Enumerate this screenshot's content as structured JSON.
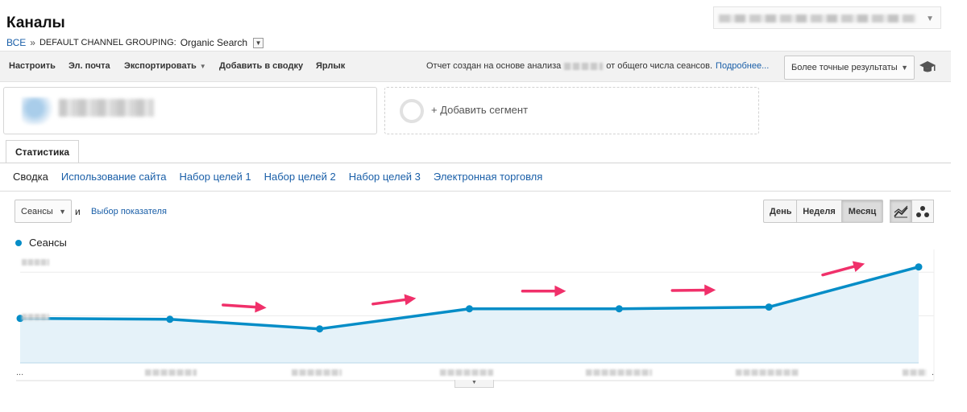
{
  "page": {
    "title": "Каналы"
  },
  "breadcrumb": {
    "all": "ВСЕ",
    "separator": "»",
    "grouping": "DEFAULT CHANNEL GROUPING:",
    "value": "Organic Search"
  },
  "toolbar": {
    "items": [
      "Настроить",
      "Эл. почта",
      "Экспортировать",
      "Добавить в сводку",
      "Ярлык"
    ],
    "note_before": "Отчет создан на основе анализа",
    "note_after": "от общего числа сеансов.",
    "note_link": "Подробнее...",
    "precision_label": "Более точные результаты"
  },
  "segments": {
    "add_label": "+ Добавить сегмент"
  },
  "tabs": {
    "main": "Статистика"
  },
  "subtabs": [
    "Сводка",
    "Использование сайта",
    "Набор целей 1",
    "Набор целей 2",
    "Набор целей 3",
    "Электронная торговля"
  ],
  "chart_controls": {
    "metric": "Сеансы",
    "and": "и",
    "pick_metric": "Выбор показателя",
    "periods": [
      "День",
      "Неделя",
      "Месяц"
    ],
    "active_period": "Месяц",
    "chart_types": [
      "line-chart-icon",
      "motion-chart-icon"
    ]
  },
  "colors": {
    "series": "#058dc7",
    "fill": "#e5f2f9",
    "annotation_arrow": "#f0306a",
    "link": "#1a5fa8"
  },
  "chart_data": {
    "type": "area",
    "x": [
      "",
      "",
      "",
      "",
      "",
      "",
      ""
    ],
    "series": [
      {
        "name": "Сеансы",
        "values": [
          0.51,
          0.5,
          0.39,
          0.62,
          0.62,
          0.64,
          1.1
        ]
      }
    ],
    "annotations": [
      "arrow",
      "arrow",
      "arrow",
      "arrow",
      "arrow"
    ],
    "ylim": [
      0,
      1.3
    ],
    "grid": true,
    "legend": "top-left",
    "x_labels_obscured": true,
    "y_labels_obscured": true
  },
  "x_axis": {
    "start": "...",
    "end": "."
  }
}
